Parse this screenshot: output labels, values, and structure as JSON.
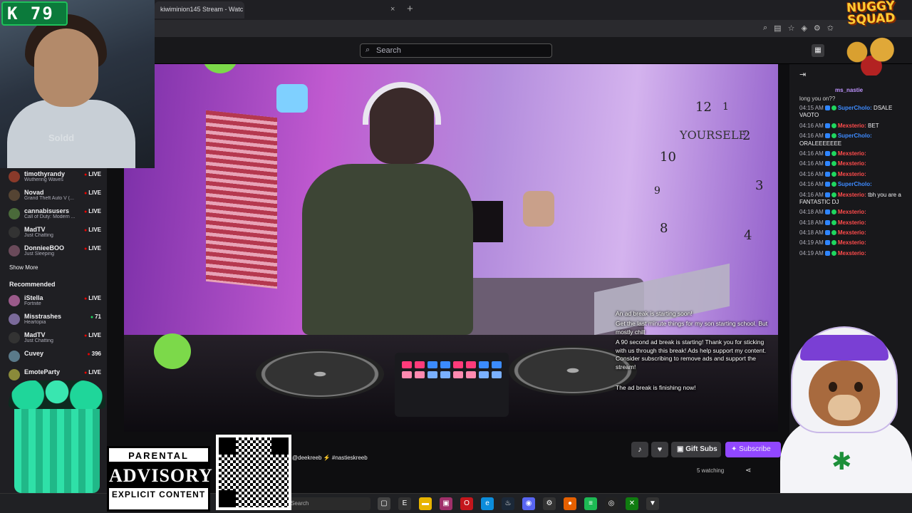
{
  "browser": {
    "tab_title": "kiwiminion145 Stream - Watc",
    "tab_close": "×",
    "new_tab": "+"
  },
  "twitch": {
    "search_placeholder": "Search"
  },
  "sidebar": {
    "followed": [
      {
        "name": "timothyrandy",
        "game": "Wuthering Waves",
        "status": "LIVE"
      },
      {
        "name": "Novad",
        "game": "Grand Theft Auto V (...",
        "status": "LIVE"
      },
      {
        "name": "cannabisusers",
        "game": "Call of Duty: Modern ...",
        "status": "LIVE"
      },
      {
        "name": "MadTV",
        "game": "Just Chatting",
        "status": "LIVE"
      },
      {
        "name": "DonnieeBOO",
        "game": "Just Sleeping",
        "status": "LIVE"
      }
    ],
    "show_more": "Show More",
    "recommended_title": "Recommended",
    "recommended": [
      {
        "name": "iStella",
        "game": "Fortnite",
        "status": "LIVE"
      },
      {
        "name": "Misstrashes",
        "game": "Heartopia",
        "status": "71"
      },
      {
        "name": "MadTV",
        "game": "Just Chatting",
        "status": "LIVE"
      },
      {
        "name": "Cuvey",
        "game": "",
        "status": "396"
      },
      {
        "name": "EmoteParty",
        "game": "",
        "status": "LIVE"
      }
    ]
  },
  "video_overlay_chat": {
    "line1": "An ad break is starting soon!",
    "line2": "Get the last minute things for my son starting school. But mostly chill",
    "line3": "A 90 second ad break is starting! Thank you for sticking with us through this break! Ads help support my content. Consider subscribing to remove ads and support the stream!",
    "line4": "The ad break is finishing now!",
    "wall_text": "YOURSELF"
  },
  "chat": {
    "pinned_user": "ms_nastie",
    "pinned_text": "long you on??",
    "messages": [
      {
        "time": "04:15 AM",
        "user": "SuperCholo:",
        "text": "DSALE VAOTO",
        "color": "blue"
      },
      {
        "time": "04:16 AM",
        "user": "Mexsterio:",
        "text": "BET",
        "color": "red"
      },
      {
        "time": "04:16 AM",
        "user": "SuperCholo:",
        "text": "ORALEEEEEEE",
        "color": "blue"
      },
      {
        "time": "04:16 AM",
        "user": "Mexsterio:",
        "text": "",
        "color": "red"
      },
      {
        "time": "04:16 AM",
        "user": "Mexsterio:",
        "text": "",
        "color": "red"
      },
      {
        "time": "04:16 AM",
        "user": "Mexsterio:",
        "text": "",
        "color": "red"
      },
      {
        "time": "04:16 AM",
        "user": "SuperCholo:",
        "text": "",
        "color": "blue"
      },
      {
        "time": "04:16 AM",
        "user": "Mexsterio:",
        "text": "tbh you are a FANTASTIC DJ",
        "color": "red"
      },
      {
        "time": "04:18 AM",
        "user": "Mexsterio:",
        "text": "",
        "color": "red"
      },
      {
        "time": "04:18 AM",
        "user": "Mexsterio:",
        "text": "",
        "color": "red"
      },
      {
        "time": "04:18 AM",
        "user": "Mexsterio:",
        "text": "",
        "color": "red"
      },
      {
        "time": "04:19 AM",
        "user": "Mexsterio:",
        "text": "",
        "color": "red"
      },
      {
        "time": "04:19 AM",
        "user": "Mexsterio:",
        "text": "",
        "color": "red"
      }
    ]
  },
  "stream_info": {
    "tags": "@deekreeb  ⚡  #nastieskreeb",
    "gift_subs": "Gift Subs",
    "subscribe": "Subscribe",
    "watching": "5 watching"
  },
  "taskbar": {
    "search": "Search"
  },
  "overlays": {
    "webcam_badge": "K 79",
    "webcam_watermark": "Soldd",
    "nuggy_title_line1": "NUGGY",
    "nuggy_title_line2": "SQUAD",
    "advisory_line1": "PARENTAL",
    "advisory_line2": "ADVISORY",
    "advisory_line3": "EXPLICIT CONTENT"
  },
  "colors": {
    "twitch_purple": "#9147ff",
    "live_red": "#eb0400",
    "background": "#0e0e10"
  }
}
